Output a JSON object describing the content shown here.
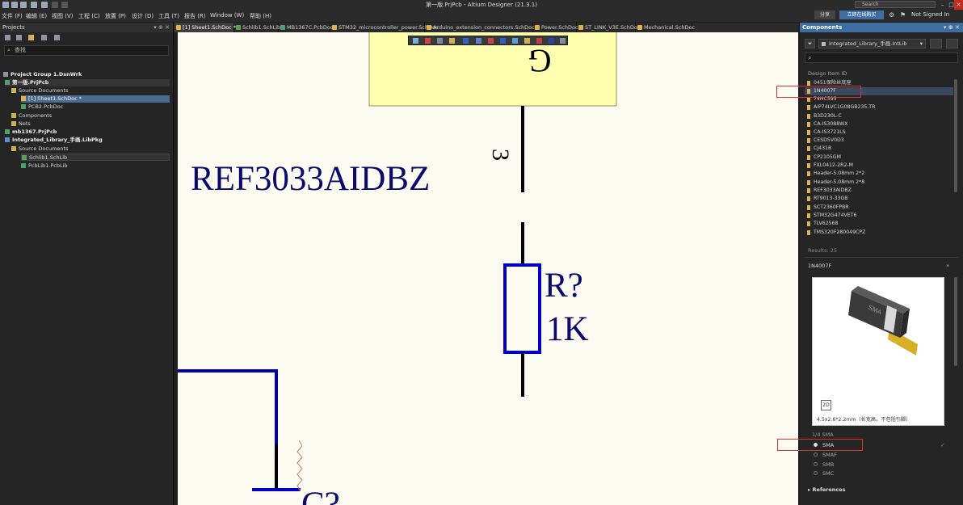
{
  "window": {
    "title": "第一版.PrjPcb - Altium Designer (21.3.1)",
    "search_placeholder": "Search",
    "share_label": "分享",
    "buy_label": "立即在线购买",
    "signin_label": "Not Signed In"
  },
  "menu": [
    "文件 (F)",
    "编辑 (E)",
    "视图 (V)",
    "工程 (C)",
    "放置 (P)",
    "设计 (D)",
    "工具 (T)",
    "报告 (R)",
    "Window (W)",
    "帮助 (H)"
  ],
  "projects_panel": {
    "title": "Projects",
    "search_placeholder": "查找",
    "tree": [
      {
        "label": "Project Group 1.DsnWrk",
        "bold": true
      },
      {
        "label": "第一版.PrjPcb",
        "bold": true
      },
      {
        "label": "Source Documents"
      },
      {
        "label": "[1] Sheet1.SchDoc *",
        "selected": true
      },
      {
        "label": "PCB2.PcbDoc"
      },
      {
        "label": "Components"
      },
      {
        "label": "Nets"
      },
      {
        "label": "mb1367.PrjPcb",
        "bold": true
      },
      {
        "label": "Integrated_Library_手画.LibPkg",
        "bold": true
      },
      {
        "label": "Source Documents"
      },
      {
        "label": "Schlib1.SchLib"
      },
      {
        "label": "PcbLib1.PcbLib"
      }
    ]
  },
  "tabs": [
    {
      "label": "[1] Sheet1.SchDoc *",
      "active": true,
      "color": "#e0b34a"
    },
    {
      "label": "Schlib1.SchLib",
      "color": "#5aa05a"
    },
    {
      "label": "MB1367C.PcbDoc",
      "color": "#4f9f6f"
    },
    {
      "label": "STM32_microcontroller_power.SchDoc",
      "color": "#e0b34a"
    },
    {
      "label": "Arduino_extension_connectors.SchDoc",
      "color": "#e0b34a"
    },
    {
      "label": "Power.SchDoc",
      "color": "#e0b34a"
    },
    {
      "label": "ST_LINK_V3E.SchDoc",
      "color": "#e0b34a"
    },
    {
      "label": "Mechanical.SchDoc",
      "color": "#e0b34a"
    }
  ],
  "schematic": {
    "component_name": "REF3033AIDBZ",
    "pin_number": "3",
    "pin_label_top": "G",
    "resistor_designator": "R?",
    "resistor_value": "1K",
    "cap_label": "C?"
  },
  "components_panel": {
    "title": "Components",
    "library": "Integrated_Library_手画.IntLib",
    "column_header": "Design Item ID",
    "items": [
      "0451保险丝底座",
      "1N4007F",
      "74HC595",
      "AiP74LVC1G08GB235.TR",
      "B3D230L-C",
      "CA-IS3088WX",
      "CA-IS3721LS",
      "CESD5V0D3",
      "CJ431B",
      "CP2105GM",
      "FXL0412-2R2-M",
      "Header-5.08mm 2*2",
      "Header-5.08mm 2*8",
      "REF3033AIDBZ",
      "RT9013-33GB",
      "SCT2360FPBR",
      "STM32G474VET6",
      "TLV62568",
      "TMS320F280049CPZ"
    ],
    "selected_item": "1N4007F",
    "results": "Results: 25",
    "detail_name": "1N4007F",
    "preview_2d": "2D",
    "preview_desc": "4.5x2.6*2.2mm（长宽高，不包括引脚）",
    "model_count": "1/4  SMA",
    "models": [
      "SMA",
      "SMAF",
      "SMB",
      "SMC"
    ],
    "selected_model": "SMA",
    "references": "References"
  },
  "colors": {
    "accent": "#3f6e9e",
    "canvas_bg": "#fcfbf2",
    "wire": "#000000",
    "graphic_blue": "#0000b4",
    "component_body": "#ffffb0",
    "highlight_box": "#e03030"
  }
}
